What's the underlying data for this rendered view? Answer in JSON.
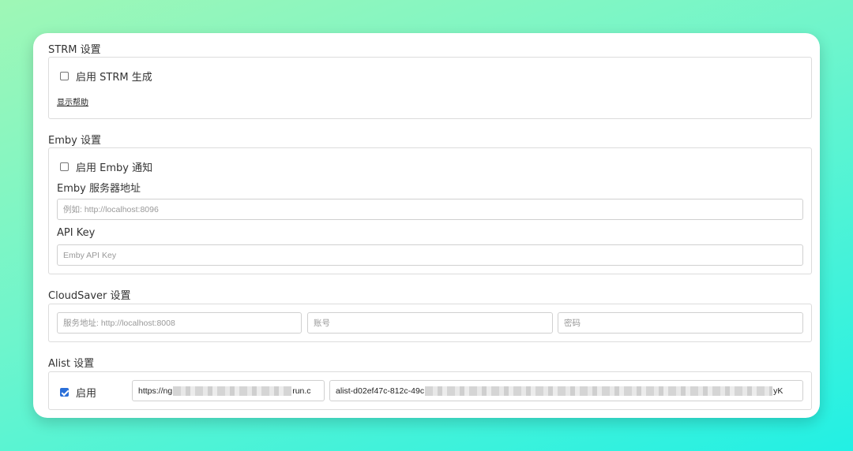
{
  "strm": {
    "title": "STRM 设置",
    "enable_label": "启用 STRM 生成",
    "help_link": "显示帮助"
  },
  "emby": {
    "title": "Emby 设置",
    "enable_label": "启用 Emby 通知",
    "server_label": "Emby 服务器地址",
    "server_placeholder": "例如: http://localhost:8096",
    "apikey_label": "API Key",
    "apikey_placeholder": "Emby API Key"
  },
  "cloudsaver": {
    "title": "CloudSaver 设置",
    "url_placeholder": "服务地址: http://localhost:8008",
    "account_placeholder": "账号",
    "password_placeholder": "密码"
  },
  "alist": {
    "title": "Alist 设置",
    "enable_label": "启用",
    "enabled": true,
    "url_prefix": "https://ng",
    "url_suffix": "run.c",
    "token_prefix": "alist-d02ef47c-812c-49c",
    "token_suffix": "yK"
  },
  "colors": {
    "accent": "#2a6fd8",
    "card_bg": "#ffffff",
    "border": "#dcdcdc"
  }
}
